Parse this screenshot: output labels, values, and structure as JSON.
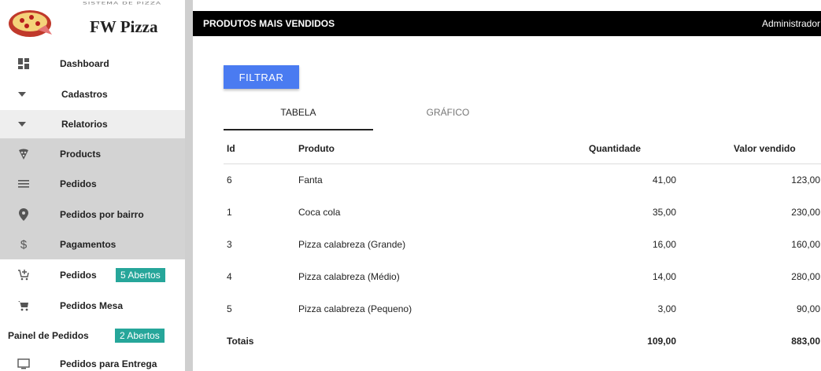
{
  "logo": {
    "small_text": "SISTEMA DE PIZZA",
    "brand": "FW Pizza"
  },
  "sidebar": {
    "items": [
      {
        "label": "Dashboard",
        "icon": "dashboard-icon"
      },
      {
        "label": "Cadastros",
        "icon": "caret-down-icon"
      },
      {
        "label": "Relatorios",
        "icon": "caret-down-icon"
      },
      {
        "label": "Products",
        "icon": "pizza-slice-icon"
      },
      {
        "label": "Pedidos",
        "icon": "list-icon"
      },
      {
        "label": "Pedidos por bairro",
        "icon": "map-pin-icon"
      },
      {
        "label": "Pagamentos",
        "icon": "dollar-icon"
      },
      {
        "label": "Pedidos",
        "icon": "add-cart-icon",
        "badge": "5 Abertos"
      },
      {
        "label": "Pedidos Mesa",
        "icon": "cart-icon"
      },
      {
        "label": "Painel de Pedidos",
        "badge": "2 Abertos"
      },
      {
        "label": "Pedidos para Entrega",
        "icon": "monitor-icon"
      }
    ]
  },
  "topbar": {
    "title": "PRODUTOS MAIS VENDIDOS",
    "user": "Administrador"
  },
  "main": {
    "filter_label": "FILTRAR",
    "tabs": [
      {
        "label": "TABELA"
      },
      {
        "label": "GRÁFICO"
      }
    ],
    "table": {
      "headers": {
        "id": "Id",
        "produto": "Produto",
        "quantidade": "Quantidade",
        "valor": "Valor vendido"
      },
      "rows": [
        {
          "id": "6",
          "produto": "Fanta",
          "quantidade": "41,00",
          "valor": "123,00"
        },
        {
          "id": "1",
          "produto": "Coca cola",
          "quantidade": "35,00",
          "valor": "230,00"
        },
        {
          "id": "3",
          "produto": "Pizza calabreza (Grande)",
          "quantidade": "16,00",
          "valor": "160,00"
        },
        {
          "id": "4",
          "produto": "Pizza calabreza (Médio)",
          "quantidade": "14,00",
          "valor": "280,00"
        },
        {
          "id": "5",
          "produto": "Pizza calabreza (Pequeno)",
          "quantidade": "3,00",
          "valor": "90,00"
        }
      ],
      "totals": {
        "label": "Totais",
        "quantidade": "109,00",
        "valor": "883,00"
      }
    }
  },
  "colors": {
    "accent_button": "#4a7bf1",
    "badge": "#26a69a",
    "topbar": "#000000"
  }
}
